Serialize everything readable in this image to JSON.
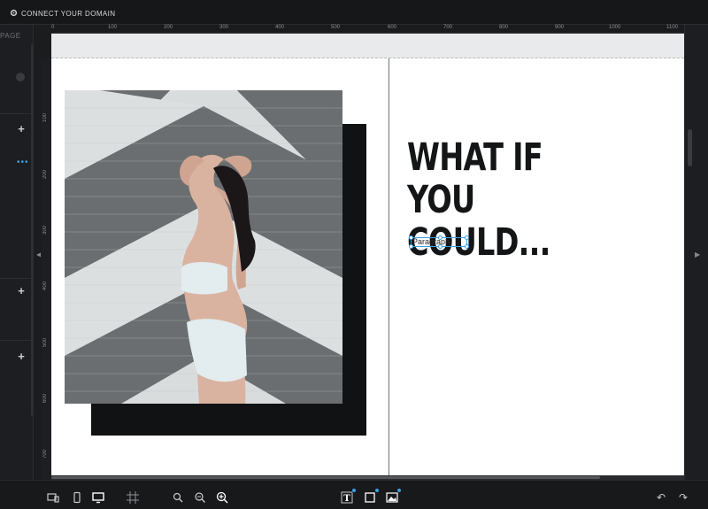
{
  "topbar": {
    "connect_label": "CONNECT YOUR DOMAIN",
    "connect_icon": "gear-icon"
  },
  "sidebar": {
    "page_label": "PAGE",
    "add_icons": [
      "plus-icon",
      "plus-icon",
      "plus-icon"
    ],
    "more_icon": "ellipsis-icon"
  },
  "ruler": {
    "top_labels": [
      "0",
      "100",
      "200",
      "300",
      "400",
      "500",
      "600",
      "700",
      "800",
      "900",
      "1000",
      "1100"
    ],
    "left_labels": [
      "100",
      "200",
      "300",
      "400",
      "500",
      "600",
      "700"
    ]
  },
  "canvas": {
    "headline_line1": "WHAT IF YOU",
    "headline_line2": "COULD...",
    "paragraph_text": "Paragraph"
  },
  "bottombar": {
    "view_icons": [
      "desktop-tablet-icon",
      "mobile-icon",
      "desktop-icon",
      "grid-icon"
    ],
    "zoom_icons": [
      "zoom-out-icon",
      "zoom-reset-icon",
      "zoom-in-icon"
    ],
    "add_icons": [
      "add-text-icon",
      "add-shape-icon",
      "add-image-icon"
    ],
    "history_icons": [
      "undo-icon",
      "redo-icon"
    ]
  },
  "colors": {
    "accent": "#39a3e4",
    "headline": "#141516",
    "shadow_block": "#111213"
  }
}
